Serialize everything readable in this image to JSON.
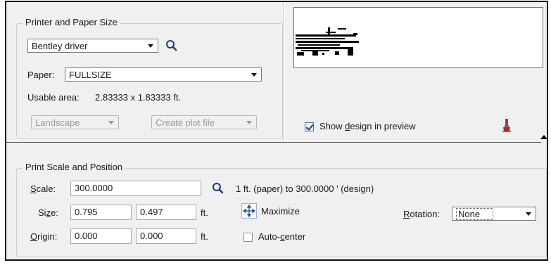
{
  "printer_paper": {
    "title": "Printer and Paper Size",
    "driver_value": "Bentley driver",
    "paper_label": "Paper:",
    "paper_value": "FULLSIZE",
    "usable_area_label": "Usable area:",
    "usable_area_value": "2.83333 x 1.83333 ft.",
    "orientation_value": "Landscape",
    "output_value": "Create plot file"
  },
  "preview": {
    "show_design_label_pre": "Show ",
    "show_design_label_mnemonic": "d",
    "show_design_label_post": "esign in preview",
    "show_design_checked": true
  },
  "print_scale": {
    "title": "Print Scale and Position",
    "scale_label_mnemonic": "S",
    "scale_label_rest": "cale:",
    "scale_value": "300.0000",
    "scale_description": "1 ft. (paper) to 300.0000 ' (design)",
    "size_label_pre": "Si",
    "size_label_mnemonic": "z",
    "size_label_post": "e:",
    "size_x": "0.795",
    "size_y": "0.497",
    "size_unit": "ft.",
    "maximize_label": "Maximize",
    "rotation_label_mnemonic": "R",
    "rotation_label_rest": "otation:",
    "rotation_value": "None",
    "origin_label_mnemonic": "O",
    "origin_label_rest": "rigin:",
    "origin_x": "0.000",
    "origin_y": "0.000",
    "origin_unit": "ft.",
    "auto_center_pre": "Auto-",
    "auto_center_mnemonic": "c",
    "auto_center_post": "enter",
    "auto_center_checked": false
  },
  "icons": {
    "driver_search": "magnifier-icon",
    "scale_search": "magnifier-icon",
    "maximize": "move-arrows-icon",
    "preview_tool": "brush-icon",
    "collapse": "triangle-up-icon"
  }
}
